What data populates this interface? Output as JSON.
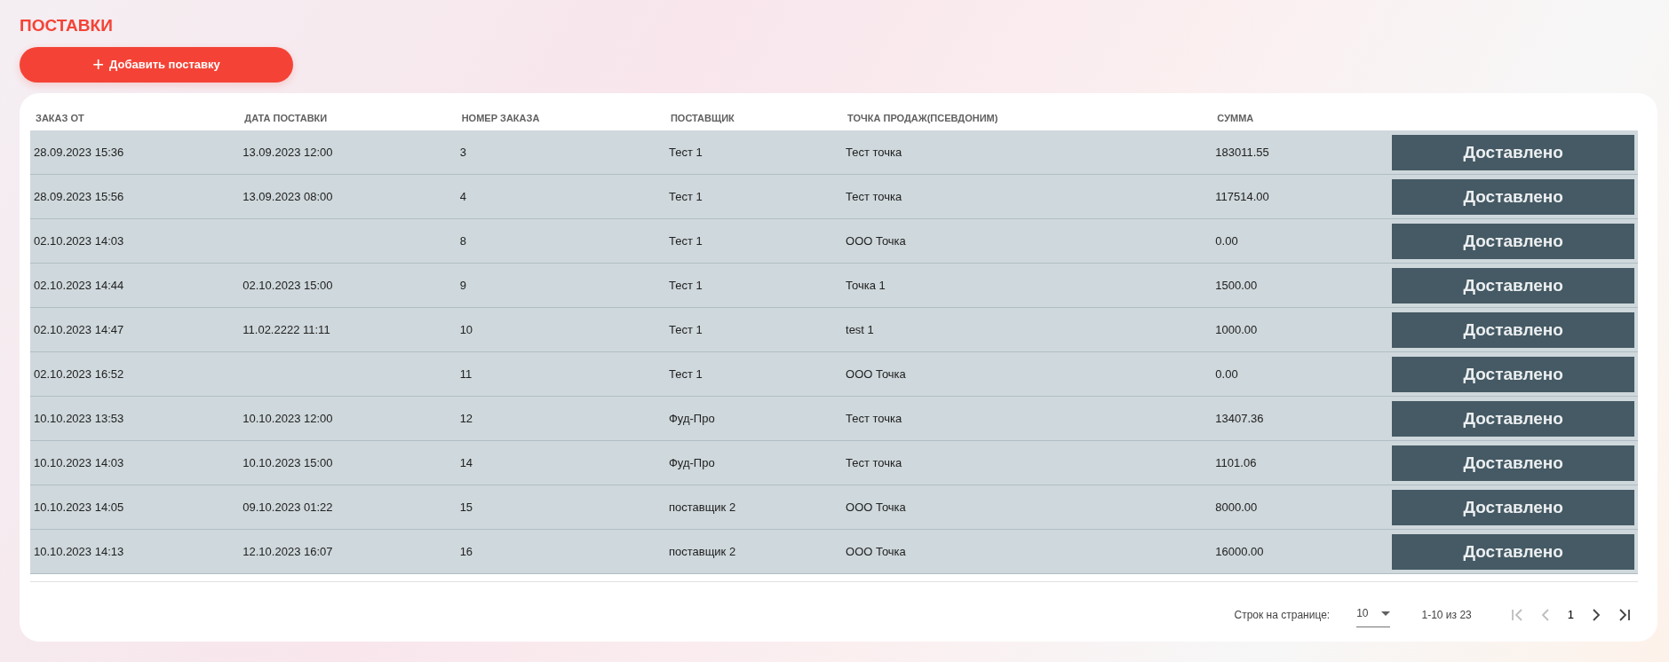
{
  "page_title": "ПОСТАВКИ",
  "add_button": {
    "icon": "+",
    "label": "Добавить поставку"
  },
  "table": {
    "columns": [
      "ЗАКАЗ ОТ",
      "ДАТА ПОСТАВКИ",
      "НОМЕР ЗАКАЗА",
      "ПОСТАВЩИК",
      "ТОЧКА ПРОДАЖ(ПСЕВДОНИМ)",
      "СУММА"
    ],
    "rows": [
      {
        "cells": [
          "28.09.2023 15:36",
          "13.09.2023 12:00",
          "3",
          "Тест 1",
          "Тест точка",
          "183011.55"
        ],
        "status": "Доставлено"
      },
      {
        "cells": [
          "28.09.2023 15:56",
          "13.09.2023 08:00",
          "4",
          "Тест 1",
          "Тест точка",
          "117514.00"
        ],
        "status": "Доставлено"
      },
      {
        "cells": [
          "02.10.2023 14:03",
          "",
          "8",
          "Тест 1",
          "ООО Точка",
          "0.00"
        ],
        "status": "Доставлено"
      },
      {
        "cells": [
          "02.10.2023 14:44",
          "02.10.2023 15:00",
          "9",
          "Тест 1",
          "Точка 1",
          "1500.00"
        ],
        "status": "Доставлено"
      },
      {
        "cells": [
          "02.10.2023 14:47",
          "11.02.2222 11:11",
          "10",
          "Тест 1",
          "test 1",
          "1000.00"
        ],
        "status": "Доставлено"
      },
      {
        "cells": [
          "02.10.2023 16:52",
          "",
          "11",
          "Тест 1",
          "ООО Точка",
          "0.00"
        ],
        "status": "Доставлено"
      },
      {
        "cells": [
          "10.10.2023 13:53",
          "10.10.2023 12:00",
          "12",
          "Фуд-Про",
          "Тест точка",
          "13407.36"
        ],
        "status": "Доставлено"
      },
      {
        "cells": [
          "10.10.2023 14:03",
          "10.10.2023 15:00",
          "14",
          "Фуд-Про",
          "Тест точка",
          "1101.06"
        ],
        "status": "Доставлено"
      },
      {
        "cells": [
          "10.10.2023 14:05",
          "09.10.2023 01:22",
          "15",
          "поставщик 2",
          "ООО Точка",
          "8000.00"
        ],
        "status": "Доставлено"
      },
      {
        "cells": [
          "10.10.2023 14:13",
          "12.10.2023 16:07",
          "16",
          "поставщик 2",
          "ООО Точка",
          "16000.00"
        ],
        "status": "Доставлено"
      }
    ]
  },
  "pagination": {
    "rows_label": "Строк на странице:",
    "rows_value": "10",
    "range": "1-10 из 23",
    "controls": [
      {
        "kind": "first",
        "disabled": true
      },
      {
        "kind": "prev",
        "disabled": true
      },
      {
        "kind": "page",
        "label": "1",
        "disabled": false
      },
      {
        "kind": "next",
        "disabled": false
      },
      {
        "kind": "last",
        "disabled": false
      }
    ]
  }
}
